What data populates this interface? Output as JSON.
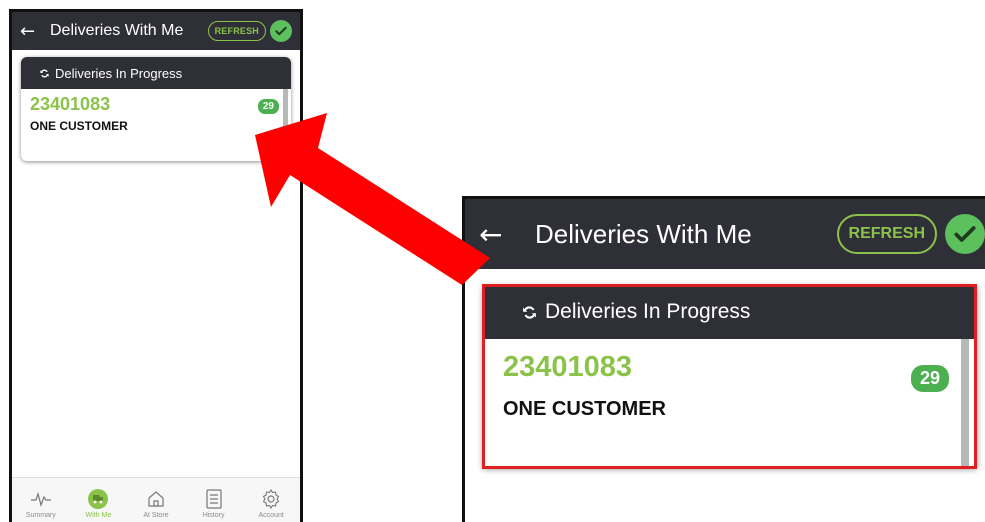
{
  "app": {
    "title": "Deliveries With Me",
    "refresh_label": "REFRESH",
    "back_icon": "arrow-left-icon",
    "status_icon": "check-circle-icon"
  },
  "section": {
    "title": "Deliveries In Progress",
    "icon": "refresh-icon"
  },
  "delivery": {
    "order_number": "23401083",
    "customer": "ONE CUSTOMER",
    "count": "29"
  },
  "tabs": [
    {
      "label": "Summary",
      "icon": "pulse-icon",
      "active": false
    },
    {
      "label": "With Me",
      "icon": "truck-icon",
      "active": true
    },
    {
      "label": "At Store",
      "icon": "store-icon",
      "active": false
    },
    {
      "label": "History",
      "icon": "history-icon",
      "active": false
    },
    {
      "label": "Account",
      "icon": "gear-icon",
      "active": false
    }
  ],
  "colors": {
    "header": "#2f3037",
    "accent_green": "#8bc34a",
    "badge_green": "#4caf50",
    "highlight_red": "#e02020"
  }
}
